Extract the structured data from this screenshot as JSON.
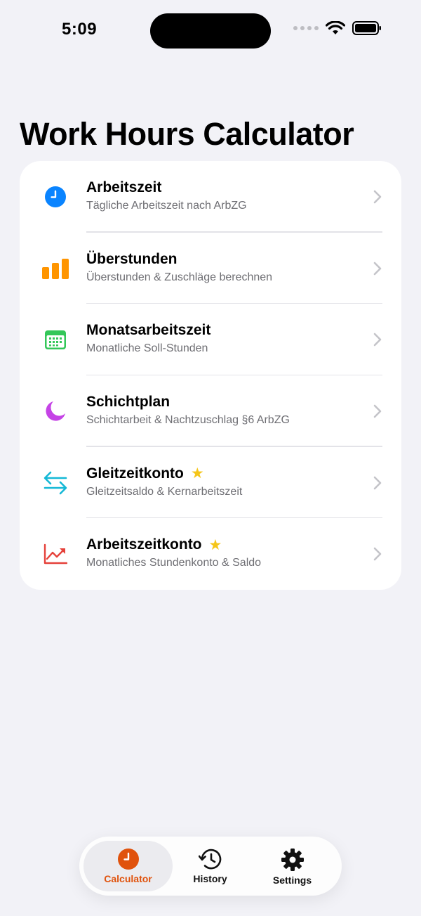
{
  "status_bar": {
    "time": "5:09"
  },
  "page_title": "Work Hours Calculator",
  "colors": {
    "background": "#f2f2f7",
    "accent": "#e0520c",
    "star": "#f5c518",
    "blue": "#0a84ff",
    "orange": "#ff9500",
    "green": "#34c759",
    "purple": "#c543e6",
    "cyan": "#14b8d6",
    "red": "#e5413a"
  },
  "calculators": [
    {
      "icon": "clock-icon",
      "title": "Arbeitszeit",
      "subtitle": "Tägliche Arbeitszeit nach ArbZG",
      "premium": false
    },
    {
      "icon": "bar-chart-icon",
      "title": "Überstunden",
      "subtitle": "Überstunden & Zuschläge berechnen",
      "premium": false
    },
    {
      "icon": "calendar-icon",
      "title": "Monatsarbeitszeit",
      "subtitle": "Monatliche Soll-Stunden",
      "premium": false
    },
    {
      "icon": "moon-icon",
      "title": "Schichtplan",
      "subtitle": "Schichtarbeit & Nachtzuschlag §6 ArbZG",
      "premium": false
    },
    {
      "icon": "arrows-swap-icon",
      "title": "Gleitzeitkonto",
      "subtitle": "Gleitzeitsaldo & Kernarbeitszeit",
      "premium": true
    },
    {
      "icon": "trend-chart-icon",
      "title": "Arbeitszeitkonto",
      "subtitle": "Monatliches Stundenkonto & Saldo",
      "premium": true
    }
  ],
  "tabbar": {
    "tabs": [
      {
        "icon": "clock-icon",
        "label": "Calculator",
        "selected": true
      },
      {
        "icon": "history-icon",
        "label": "History",
        "selected": false
      },
      {
        "icon": "gear-icon",
        "label": "Settings",
        "selected": false
      }
    ]
  }
}
